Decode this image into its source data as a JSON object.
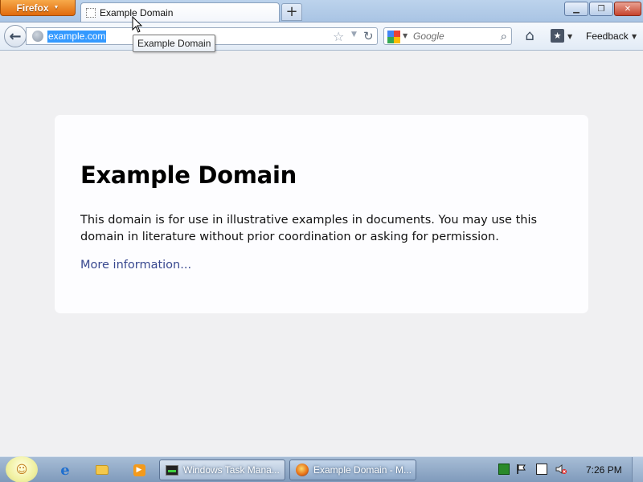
{
  "browser": {
    "app_menu_label": "Firefox",
    "tab": {
      "title": "Example Domain"
    },
    "new_tab_label": "+",
    "window_controls": {
      "minimize_icon": "minimize-icon",
      "maximize_icon": "restore-icon",
      "close_icon": "close-icon"
    }
  },
  "navbar": {
    "url": "example.com",
    "search": {
      "engine_icon": "google-icon",
      "placeholder": "Google"
    },
    "feedback_label": "Feedback"
  },
  "tooltip": {
    "text": "Example Domain"
  },
  "page": {
    "heading": "Example Domain",
    "body": "This domain is for use in illustrative examples in documents. You may use this domain in literature without prior coordination or asking for permission.",
    "link": "More information..."
  },
  "taskbar": {
    "tasks": [
      {
        "label": "Windows Task Mana...",
        "icon": "task-manager-icon"
      },
      {
        "label": "Example Domain - M...",
        "icon": "firefox-icon"
      }
    ],
    "clock": "7:26 PM"
  },
  "colors": {
    "page_background": "#f0f0f2",
    "card_background": "#fdfdff",
    "link": "#38488f",
    "url_selection": "#3399ff",
    "firefox_button": "#e06a0c"
  }
}
